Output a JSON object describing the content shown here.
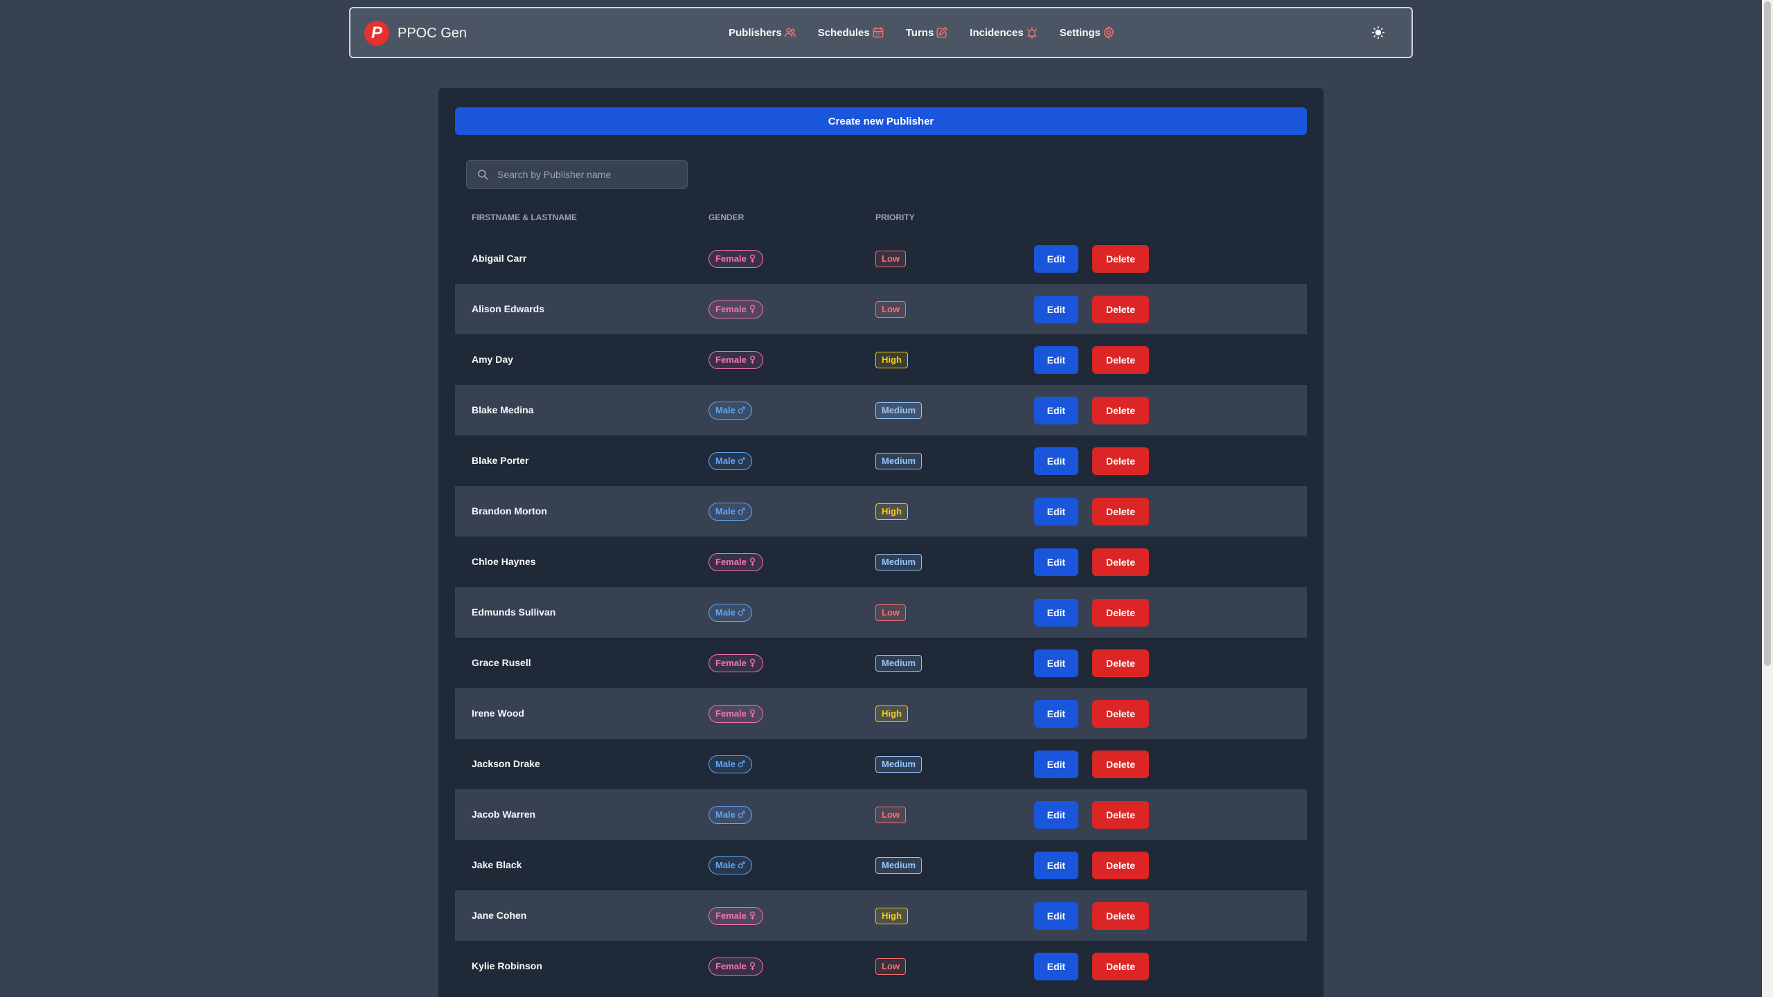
{
  "navbar": {
    "logo_letter": "P",
    "brand": "PPOC Gen",
    "links": [
      {
        "label": "Publishers",
        "icon": "users-icon"
      },
      {
        "label": "Schedules",
        "icon": "calendar-icon"
      },
      {
        "label": "Turns",
        "icon": "edit-icon"
      },
      {
        "label": "Incidences",
        "icon": "alarm-icon"
      },
      {
        "label": "Settings",
        "icon": "gear-icon"
      }
    ],
    "theme_icon": "sun-icon"
  },
  "main": {
    "create_label": "Create new Publisher",
    "search_placeholder": "Search by Publisher name",
    "columns": [
      "Firstname & Lastname",
      "Gender",
      "Priority",
      ""
    ],
    "edit_label": "Edit",
    "delete_label": "Delete",
    "rows": [
      {
        "name": "Abigail Carr",
        "gender": "Female",
        "priority": "Low"
      },
      {
        "name": "Alison Edwards",
        "gender": "Female",
        "priority": "Low"
      },
      {
        "name": "Amy Day",
        "gender": "Female",
        "priority": "High"
      },
      {
        "name": "Blake Medina",
        "gender": "Male",
        "priority": "Medium"
      },
      {
        "name": "Blake Porter",
        "gender": "Male",
        "priority": "Medium"
      },
      {
        "name": "Brandon Morton",
        "gender": "Male",
        "priority": "High"
      },
      {
        "name": "Chloe Haynes",
        "gender": "Female",
        "priority": "Medium"
      },
      {
        "name": "Edmunds Sullivan",
        "gender": "Male",
        "priority": "Low"
      },
      {
        "name": "Grace Rusell",
        "gender": "Female",
        "priority": "Medium"
      },
      {
        "name": "Irene Wood",
        "gender": "Female",
        "priority": "High"
      },
      {
        "name": "Jackson Drake",
        "gender": "Male",
        "priority": "Medium"
      },
      {
        "name": "Jacob Warren",
        "gender": "Male",
        "priority": "Low"
      },
      {
        "name": "Jake Black",
        "gender": "Male",
        "priority": "Medium"
      },
      {
        "name": "Jane Cohen",
        "gender": "Female",
        "priority": "High"
      },
      {
        "name": "Kylie Robinson",
        "gender": "Female",
        "priority": "Low"
      }
    ]
  },
  "colors": {
    "background": "#374151",
    "panel": "#1f2937",
    "primary": "#1a56db",
    "danger": "#dc2626",
    "female": "#f472b6",
    "male": "#60a5fa",
    "low": "#f87171",
    "high": "#facc15",
    "medium": "#93c5fd"
  }
}
